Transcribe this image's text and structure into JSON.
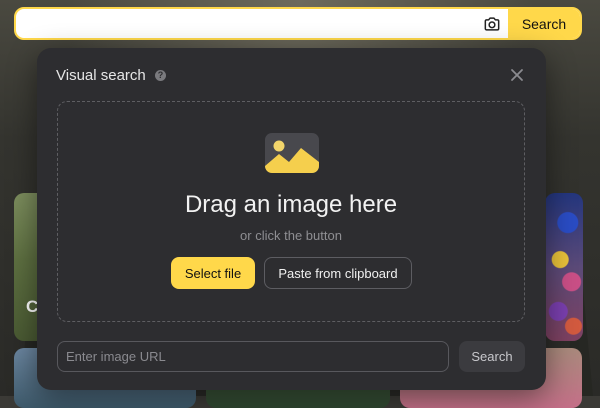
{
  "search": {
    "value": "",
    "button_label": "Search",
    "camera_icon": "camera-icon"
  },
  "background": {
    "tile_left_text": "C"
  },
  "popup": {
    "title": "Visual search",
    "help_icon": "help-icon",
    "close_icon": "close-icon",
    "image_icon": "image-icon",
    "drop_title": "Drag an image here",
    "drop_subtitle": "or click the button",
    "select_file_label": "Select file",
    "paste_label": "Paste from clipboard",
    "url_placeholder": "Enter image URL",
    "url_value": "",
    "url_search_label": "Search"
  },
  "colors": {
    "accent": "#ffd84a",
    "popup_bg": "#2d2d30"
  }
}
